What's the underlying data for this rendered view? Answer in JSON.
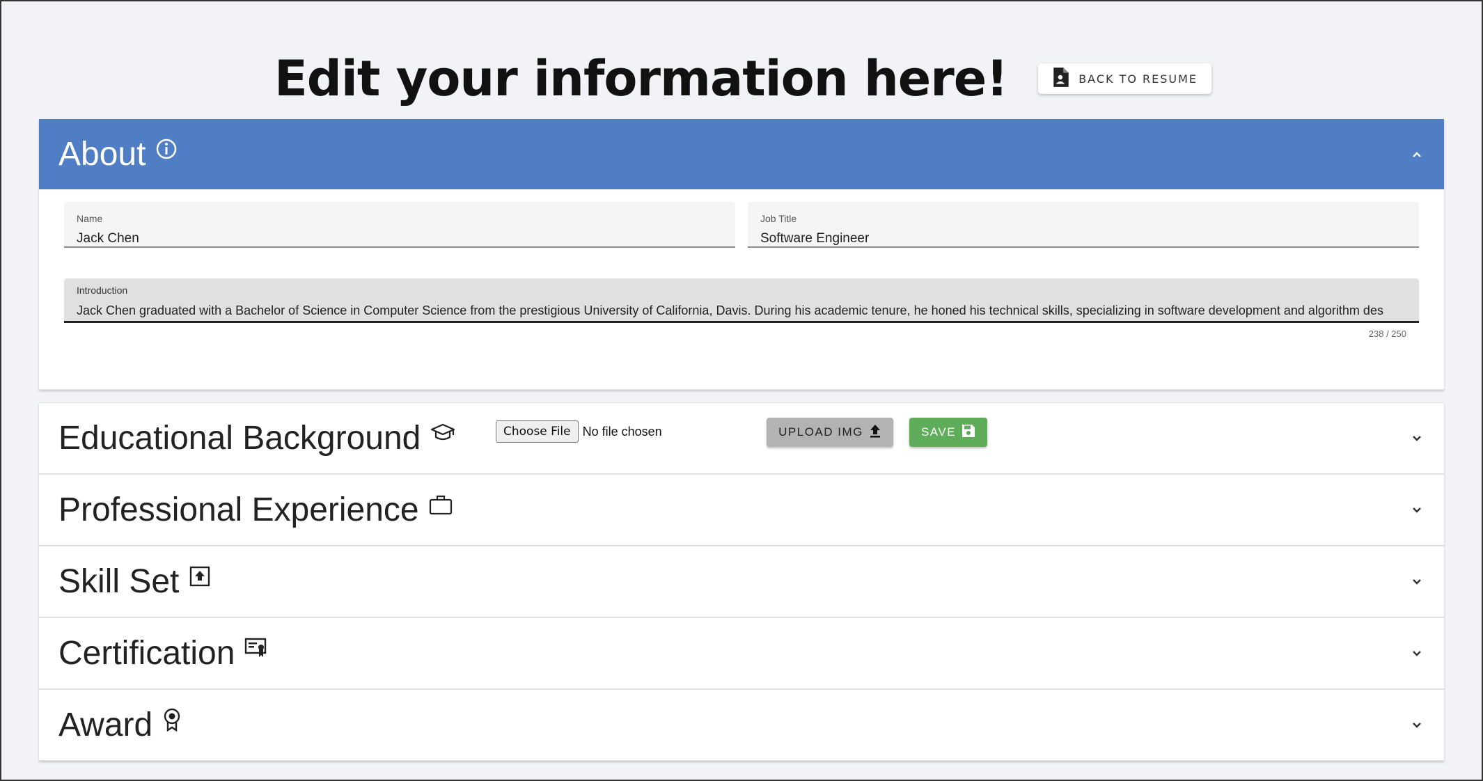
{
  "header": {
    "title": "Edit your information here!",
    "back_button": "BACK TO RESUME"
  },
  "about": {
    "title": "About",
    "icon": "info-icon",
    "name_label": "Name",
    "name_value": "Jack Chen",
    "job_label": "Job Title",
    "job_value": "Software Engineer",
    "intro_label": "Introduction",
    "intro_value": "Jack Chen graduated with a Bachelor of Science in Computer Science from the prestigious University of California, Davis. During his academic tenure, he honed his technical skills, specializing in software development and algorithm des",
    "counter": "238 / 250",
    "choose_file": "Choose File",
    "no_file": "No file chosen",
    "upload_label": "UPLOAD IMG",
    "save_label": "SAVE"
  },
  "sections": [
    {
      "title": "Educational Background",
      "icon": "graduation-cap-icon"
    },
    {
      "title": "Professional Experience",
      "icon": "briefcase-icon"
    },
    {
      "title": "Skill Set",
      "icon": "upload-box-icon"
    },
    {
      "title": "Certification",
      "icon": "certificate-icon"
    },
    {
      "title": "Award",
      "icon": "award-icon"
    }
  ],
  "colors": {
    "about_header": "#4f7ec4",
    "save": "#5fad5a",
    "upload": "#b3b3b3",
    "background": "#f2f3f6"
  }
}
